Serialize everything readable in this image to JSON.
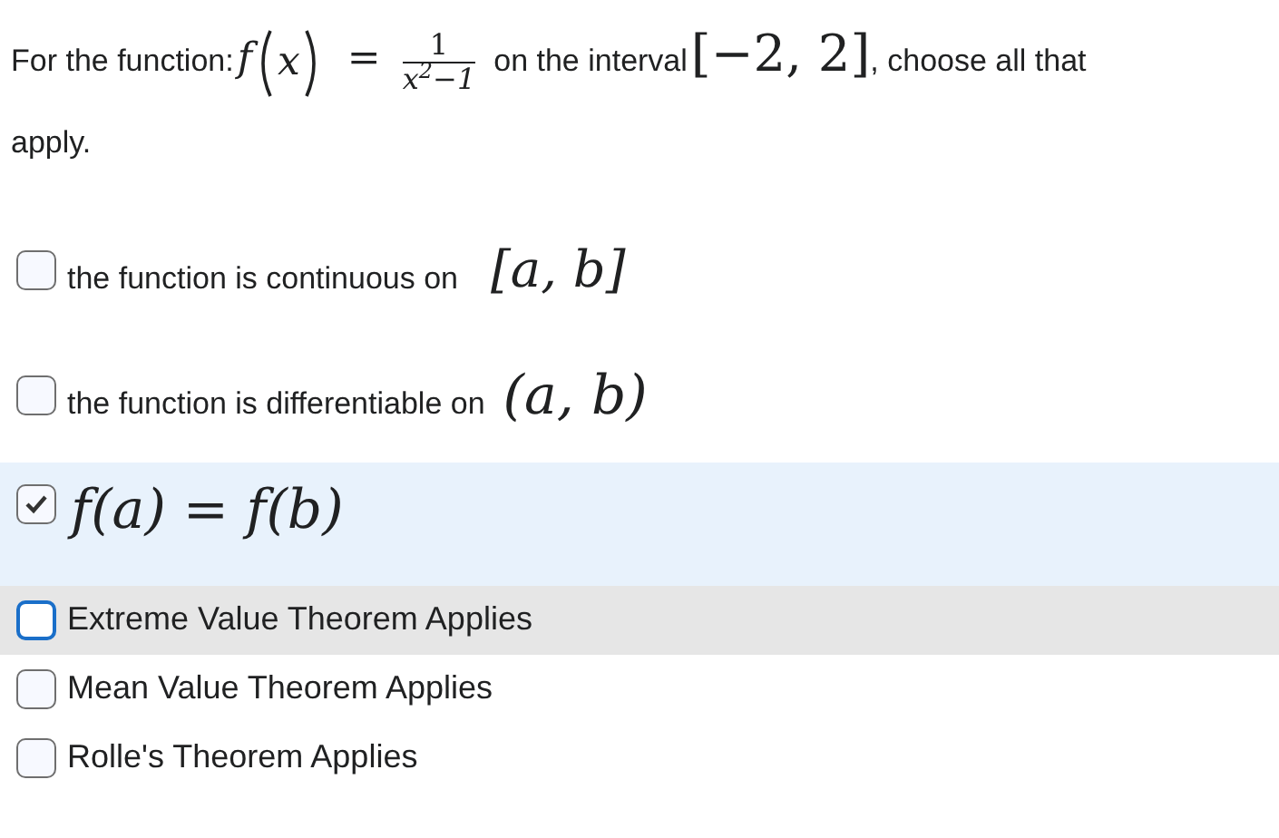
{
  "question": {
    "prefix": "For the function:",
    "function": "f",
    "variable": "x",
    "equals": "=",
    "numerator": "1",
    "denominator": "x$^{2}$−1",
    "middle": "on the interval",
    "interval": "[−2, 2]",
    "suffix": ", choose all that",
    "continuation": "apply."
  },
  "options": [
    {
      "text": "the function is continuous on",
      "math": "[a, b]",
      "checked": false,
      "hovered": false
    },
    {
      "text": "the function is differentiable on",
      "math": "(a, b)",
      "checked": false,
      "hovered": false
    },
    {
      "math": "f(a) = f(b)",
      "checked": true,
      "hovered": false
    },
    {
      "text": "Extreme Value Theorem Applies",
      "checked": false,
      "hovered": true
    },
    {
      "text": "Mean Value Theorem Applies",
      "checked": false,
      "hovered": false
    },
    {
      "text": "Rolle's Theorem Applies",
      "checked": false,
      "hovered": false
    }
  ]
}
